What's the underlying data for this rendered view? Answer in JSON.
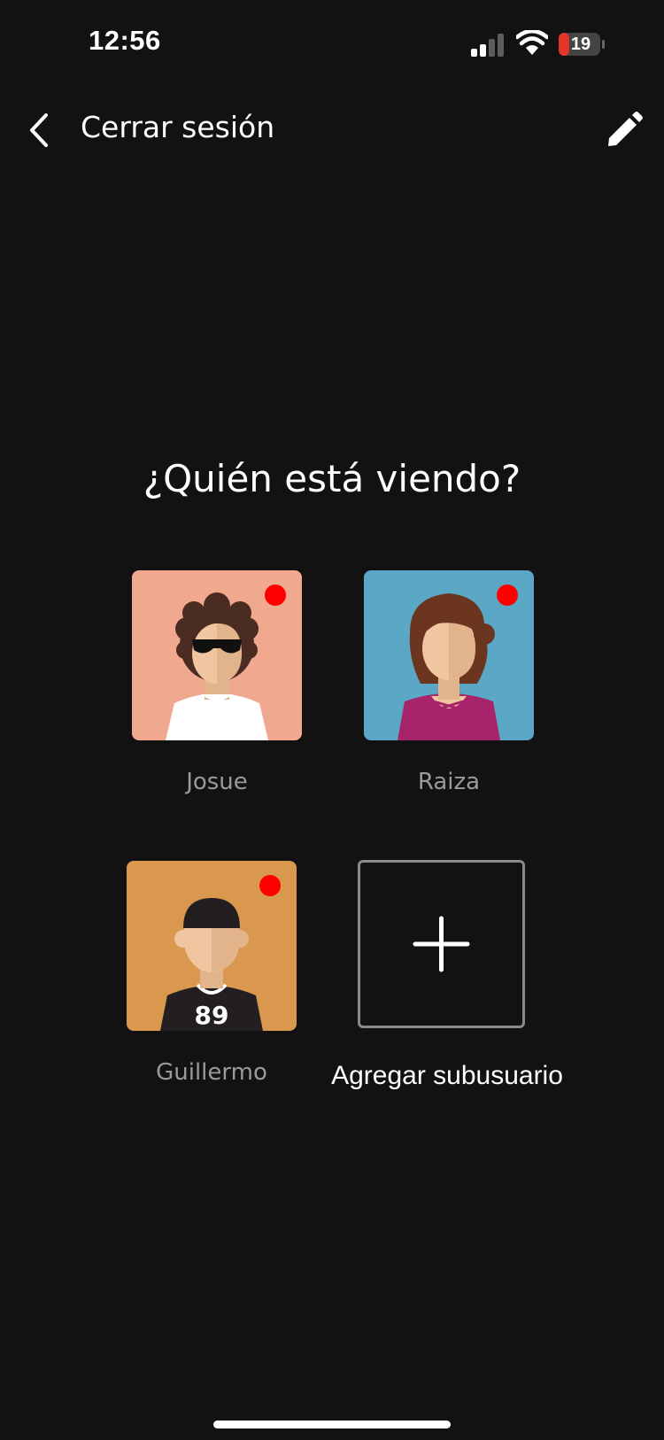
{
  "status_bar": {
    "time": "12:56",
    "battery_level": "19",
    "battery_color": "#e5352b"
  },
  "header": {
    "back_icon": "chevron-left-icon",
    "title": "Cerrar sesión",
    "edit_icon": "pencil-icon"
  },
  "heading": "¿Quién está viendo?",
  "profiles": [
    {
      "name": "Josue",
      "avatar": "avatar-curly-hair-sunglasses",
      "background": "#f0a88f",
      "notification": true
    },
    {
      "name": "Raiza",
      "avatar": "avatar-woman-brown-hair",
      "background": "#5aa8c6",
      "notification": true
    },
    {
      "name": "Guillermo",
      "avatar": "avatar-cap-jersey",
      "background": "#d9984e",
      "notification": true,
      "jersey_number": "89"
    }
  ],
  "add_subuser": {
    "icon": "plus-icon",
    "label": "Agregar subusuario"
  },
  "colors": {
    "background": "#121212",
    "notification_dot": "#ff0000",
    "secondary_text": "#9a9a9a"
  }
}
